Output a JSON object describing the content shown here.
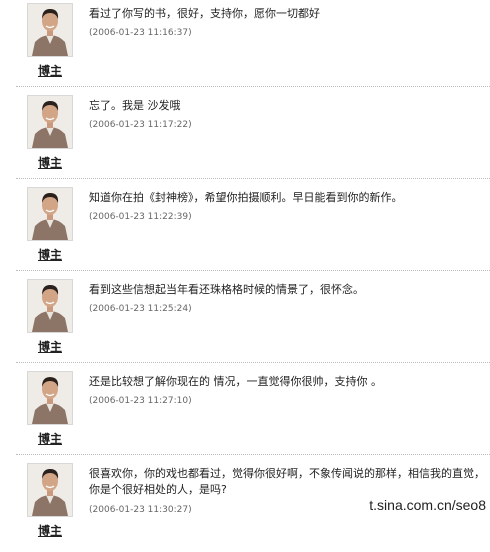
{
  "comments": [
    {
      "author": "博主",
      "text": "看过了你写的书，很好，支持你，愿你一切都好",
      "time": "(2006-01-23 11:16:37)"
    },
    {
      "author": "博主",
      "text": "忘了。我是 沙发哦",
      "time": "(2006-01-23 11:17:22)"
    },
    {
      "author": "博主",
      "text": "知道你在拍《封神榜》，希望你拍摄顺利。早日能看到你的新作。",
      "time": "(2006-01-23 11:22:39)"
    },
    {
      "author": "博主",
      "text": "看到这些信想起当年看还珠格格时候的情景了，很怀念。",
      "time": "(2006-01-23 11:25:24)"
    },
    {
      "author": "博主",
      "text": "还是比较想了解你现在的 情况，一直觉得你很帅，支持你 。",
      "time": "(2006-01-23 11:27:10)"
    },
    {
      "author": "博主",
      "text": "很喜欢你，你的戏也都看过，觉得你很好啊，不象传闻说的那样，相信我的直觉，你是个很好相处的人，是吗?",
      "time": "(2006-01-23 11:30:27)"
    }
  ],
  "watermark": "t.sina.com.cn/seo8",
  "colors": {
    "text": "#222222",
    "time": "#666666",
    "divider": "#bdbdbd",
    "jacket": "#8c7466"
  },
  "avatar_icon": "user-photo-icon"
}
